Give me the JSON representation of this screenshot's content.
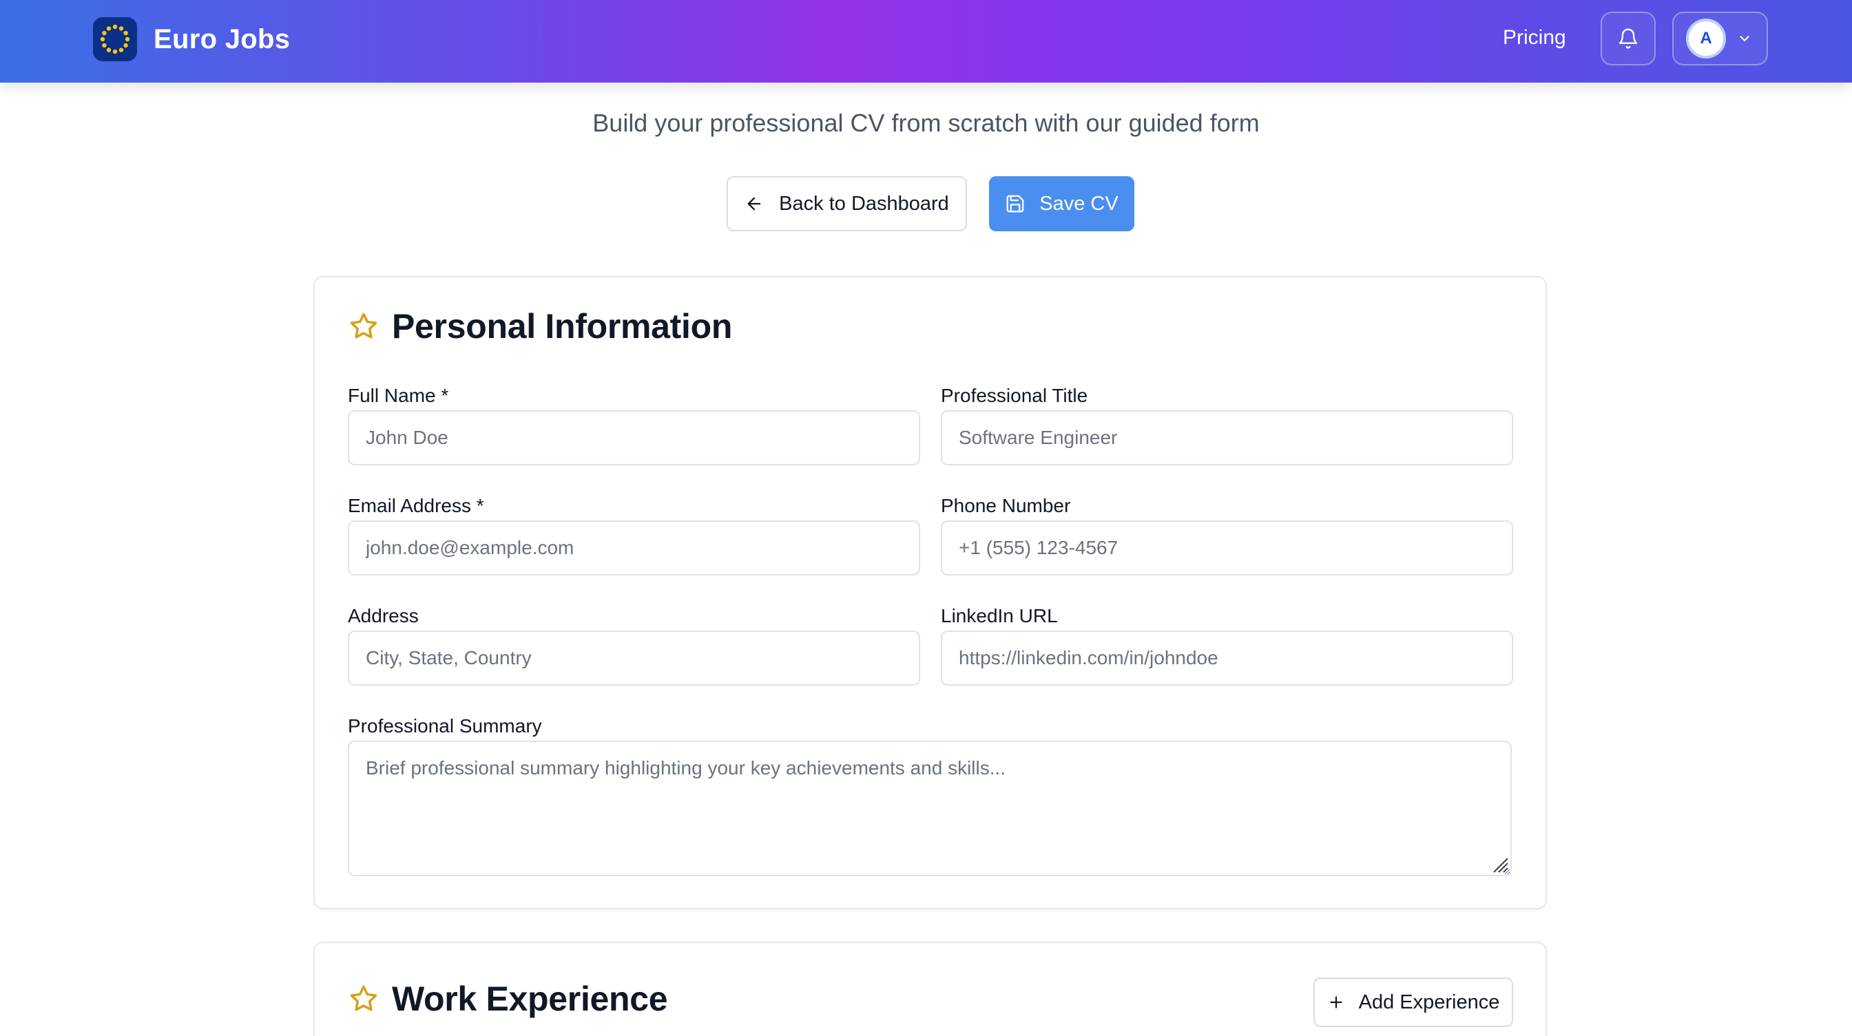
{
  "brand": {
    "name": "Euro Jobs",
    "logo_icon": "eu-stars-icon"
  },
  "nav": {
    "pricing": "Pricing",
    "bell_icon": "bell-icon",
    "avatar_initial": "A",
    "chevron_icon": "chevron-down-icon"
  },
  "header": {
    "subtitle": "Build your professional CV from scratch with our guided form",
    "back_label": "Back to Dashboard",
    "save_label": "Save CV"
  },
  "personal": {
    "title": "Personal Information",
    "full_name": {
      "label": "Full Name *",
      "placeholder": "John Doe",
      "value": ""
    },
    "professional_title": {
      "label": "Professional Title",
      "placeholder": "Software Engineer",
      "value": ""
    },
    "email": {
      "label": "Email Address *",
      "placeholder": "john.doe@example.com",
      "value": ""
    },
    "phone": {
      "label": "Phone Number",
      "placeholder": "+1 (555) 123-4567",
      "value": ""
    },
    "address": {
      "label": "Address",
      "placeholder": "City, State, Country",
      "value": ""
    },
    "linkedin": {
      "label": "LinkedIn URL",
      "placeholder": "https://linkedin.com/in/johndoe",
      "value": ""
    },
    "summary": {
      "label": "Professional Summary",
      "placeholder": "Brief professional summary highlighting your key achievements and skills...",
      "value": ""
    }
  },
  "work": {
    "title": "Work Experience",
    "add_label": "Add Experience"
  },
  "colors": {
    "primary_button": "#4a8ff0",
    "star": "#d4a017",
    "nav_gradient_start": "#3b6fe6",
    "nav_gradient_mid": "#9333ea",
    "logo_bg": "#0b2f86"
  }
}
